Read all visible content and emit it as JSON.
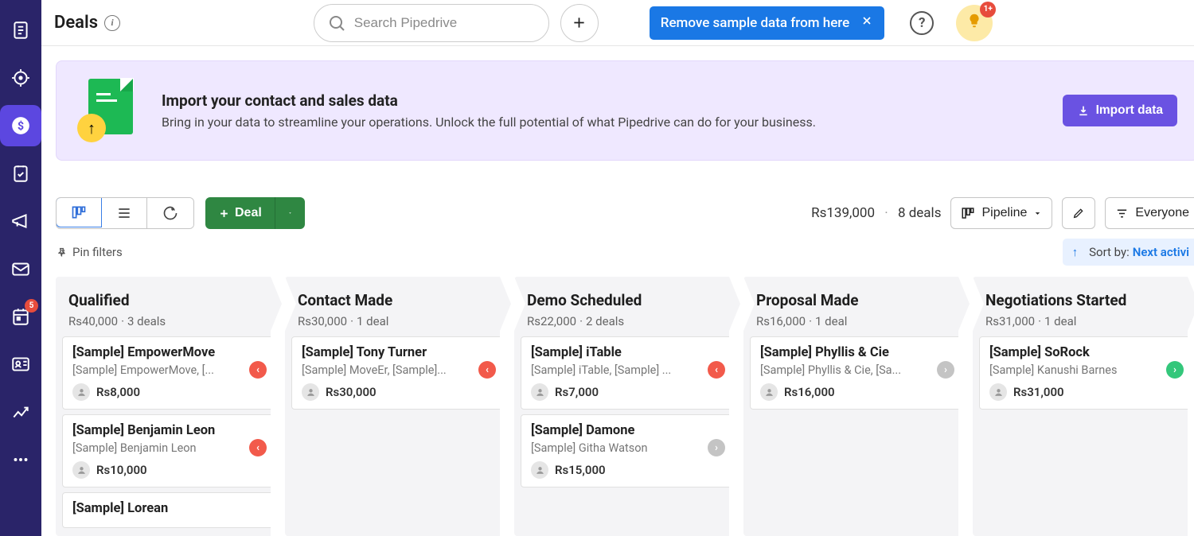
{
  "header": {
    "title": "Deals",
    "search_placeholder": "Search Pipedrive",
    "remove_label": "Remove sample data from here",
    "bulb_badge": "1+"
  },
  "nav": {
    "badge5": "5"
  },
  "promo": {
    "title": "Import your contact and sales data",
    "desc": "Bring in your data to streamline your operations. Unlock the full potential of what Pipedrive can do for your business.",
    "button": "Import data"
  },
  "toolbar": {
    "deal_label": "Deal",
    "total_value": "Rs139,000",
    "deal_count": "8 deals",
    "pipeline_label": "Pipeline",
    "filter_label": "Everyone"
  },
  "subbar": {
    "pin": "Pin filters",
    "sort_label": "Sort by:",
    "sort_value": "Next activi"
  },
  "columns": [
    {
      "title": "Qualified",
      "value": "Rs40,000",
      "count": "3 deals",
      "cards": [
        {
          "title": "[Sample] EmpowerMove",
          "sub": "[Sample] EmpowerMove, [...",
          "amount": "Rs8,000",
          "status": "red"
        },
        {
          "title": "[Sample] Benjamin Leon",
          "sub": "[Sample] Benjamin Leon",
          "amount": "Rs10,000",
          "status": "red"
        },
        {
          "title": "[Sample] Lorean",
          "sub": "",
          "amount": "",
          "status": ""
        }
      ]
    },
    {
      "title": "Contact Made",
      "value": "Rs30,000",
      "count": "1 deal",
      "cards": [
        {
          "title": "[Sample] Tony Turner",
          "sub": "[Sample] MoveEr, [Sample]...",
          "amount": "Rs30,000",
          "status": "red"
        }
      ]
    },
    {
      "title": "Demo Scheduled",
      "value": "Rs22,000",
      "count": "2 deals",
      "cards": [
        {
          "title": "[Sample] iTable",
          "sub": "[Sample] iTable, [Sample] ...",
          "amount": "Rs7,000",
          "status": "red"
        },
        {
          "title": "[Sample] Damone",
          "sub": "[Sample] Githa Watson",
          "amount": "Rs15,000",
          "status": "gray"
        }
      ]
    },
    {
      "title": "Proposal Made",
      "value": "Rs16,000",
      "count": "1 deal",
      "cards": [
        {
          "title": "[Sample] Phyllis & Cie",
          "sub": "[Sample] Phyllis & Cie, [Sa...",
          "amount": "Rs16,000",
          "status": "gray"
        }
      ]
    },
    {
      "title": "Negotiations Started",
      "value": "Rs31,000",
      "count": "1 deal",
      "cards": [
        {
          "title": "[Sample] SoRock",
          "sub": "[Sample] Kanushi Barnes",
          "amount": "Rs31,000",
          "status": "green"
        }
      ]
    }
  ]
}
